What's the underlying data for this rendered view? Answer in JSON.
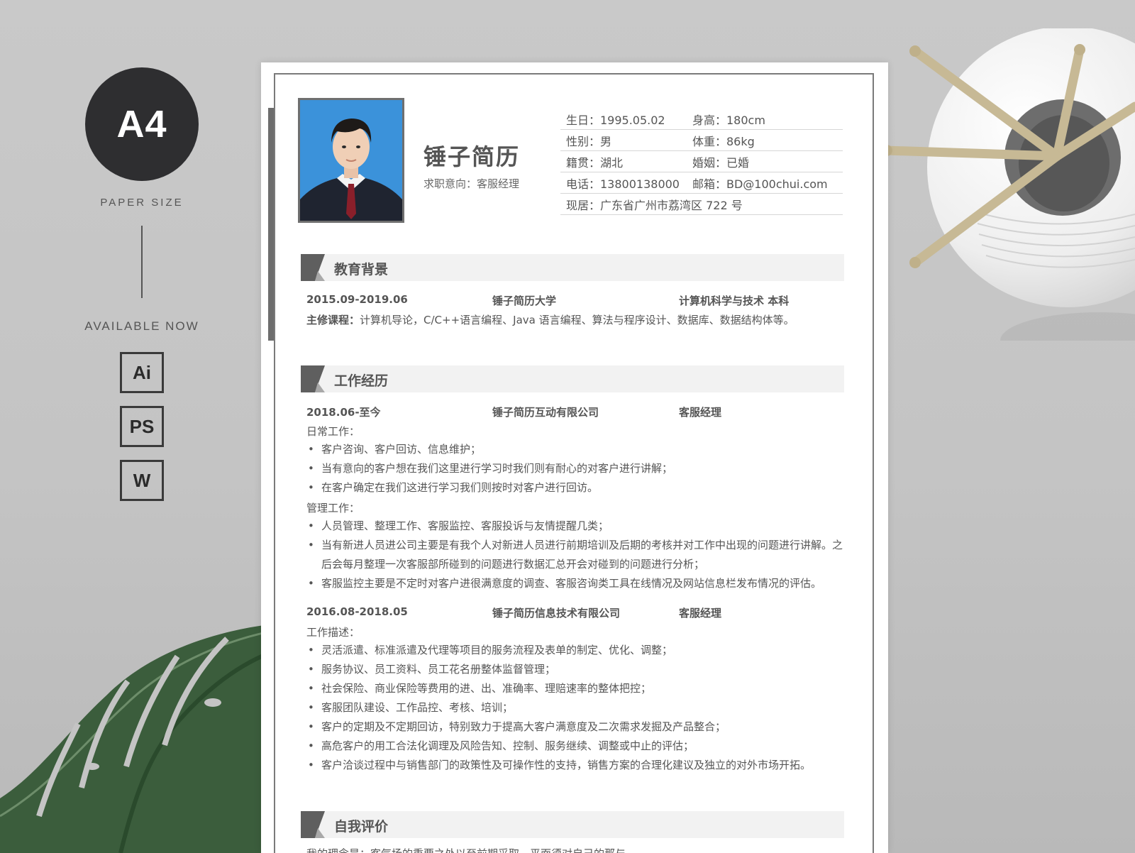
{
  "promo": {
    "size_label": "A4",
    "paper_size": "PAPER SIZE",
    "available": "AVAILABLE NOW",
    "formats": [
      "Ai",
      "PS",
      "W"
    ]
  },
  "resume": {
    "name": "锤子简历",
    "intent_label": "求职意向：",
    "intent_value": "客服经理",
    "info": [
      [
        "生日：1995.05.02",
        "身高：180cm"
      ],
      [
        "性别：男",
        "体重：86kg"
      ],
      [
        "籍贯：湖北",
        "婚姻：已婚"
      ],
      [
        "电话：13800138000",
        "邮箱：BD@100chui.com"
      ],
      [
        "现居：广东省广州市荔湾区 722 号",
        ""
      ]
    ],
    "education": {
      "title": "教育背景",
      "period": "2015.09-2019.06",
      "school": "锤子简历大学",
      "major": "计算机科学与技术  本科",
      "courses_label": "主修课程：",
      "courses": "计算机导论，C/C++语言编程、Java 语言编程、算法与程序设计、数据库、数据结构体等。"
    },
    "work": {
      "title": "工作经历",
      "jobs": [
        {
          "period": "2018.06-至今",
          "company": "锤子简历互动有限公司",
          "role": "客服经理",
          "daily_label": "日常工作：",
          "daily": [
            "客户咨询、客户回访、信息维护；",
            "当有意向的客户想在我们这里进行学习时我们则有耐心的对客户进行讲解；",
            "在客户确定在我们这进行学习我们则按时对客户进行回访。"
          ],
          "manage_label": "管理工作：",
          "manage": [
            "人员管理、整理工作、客服监控、客服投诉与友情提醒几类；",
            "当有新进人员进公司主要是有我个人对新进人员进行前期培训及后期的考核并对工作中出现的问题进行讲解。之后会每月整理一次客服部所碰到的问题进行数据汇总开会对碰到的问题进行分析；",
            "客服监控主要是不定时对客户进很满意度的调查、客服咨询类工具在线情况及网站信息栏发布情况的评估。"
          ]
        },
        {
          "period": "2016.08-2018.05",
          "company": "锤子简历信息技术有限公司",
          "role": "客服经理",
          "desc_label": "工作描述：",
          "desc": [
            "灵活派遣、标准派遣及代理等项目的服务流程及表单的制定、优化、调整；",
            "服务协议、员工资料、员工花名册整体监督管理；",
            "社会保险、商业保险等费用的进、出、准确率、理赔速率的整体把控；",
            "客服团队建设、工作品控、考核、培训；",
            "客户的定期及不定期回访，特别致力于提高大客户满意度及二次需求发掘及产品整合；",
            "高危客户的用工合法化调理及风险告知、控制、服务继续、调整或中止的评估；",
            "客户洽谈过程中与销售部门的政策性及可操作性的支持，销售方案的合理化建议及独立的对外市场开拓。"
          ]
        }
      ]
    },
    "self": {
      "title": "自我评价",
      "text": "我的理念是：客气场的重要之处以至前期采取，平面须对自己的那与…"
    }
  }
}
